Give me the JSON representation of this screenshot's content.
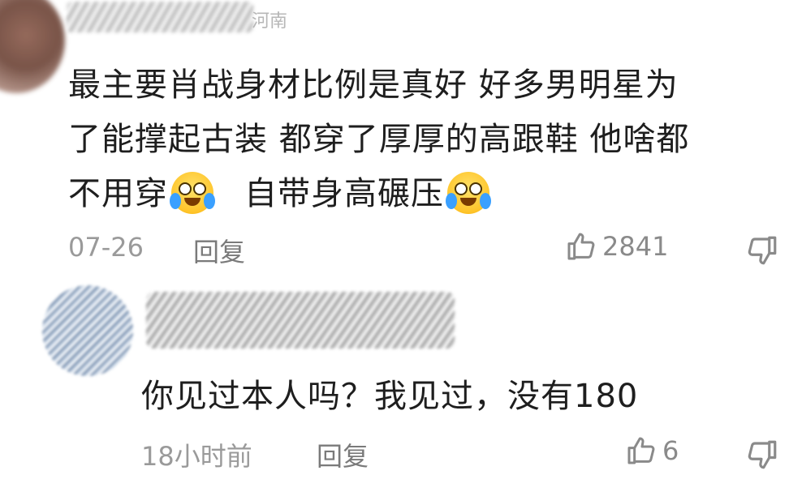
{
  "comment": {
    "location": "河南",
    "lines": [
      "最主要肖战身材比例是真好  好多男明星为",
      "了能撑起古装 都穿了厚厚的高跟鞋   他啥都"
    ],
    "line3_part1": "不用穿",
    "line3_part2": "自带身高碾压",
    "emoji_name": "crying-laughing-emoji",
    "date": "07-26",
    "reply_label": "回复",
    "likes": "2841",
    "icons": {
      "like": "thumbs-up-icon",
      "dislike": "thumbs-down-icon"
    }
  },
  "reply": {
    "text": "你见过本人吗？我见过，没有180",
    "time": "18小时前",
    "reply_label": "回复",
    "likes": "6"
  },
  "colors": {
    "meta_text": "#9a9a9a",
    "body_text": "#1e1e1e",
    "background": "#ffffff"
  }
}
